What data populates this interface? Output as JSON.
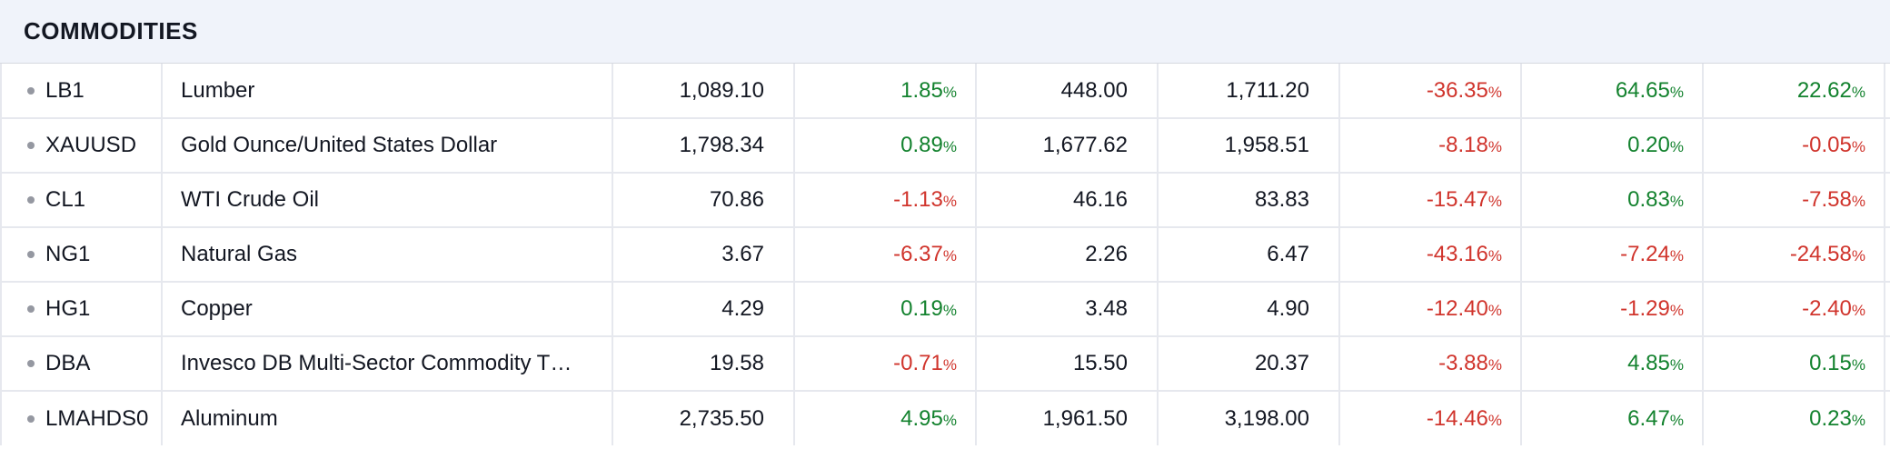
{
  "header": {
    "title": "COMMODITIES"
  },
  "rows": [
    {
      "symbol": "LB1",
      "name": "Lumber",
      "price": "1,089.10",
      "chg": {
        "value": "1.85",
        "unit": "%",
        "dir": "pos"
      },
      "low": "448.00",
      "high": "1,711.20",
      "p1": {
        "value": "-36.35",
        "unit": "%",
        "dir": "neg"
      },
      "p2": {
        "value": "64.65",
        "unit": "%",
        "dir": "pos"
      },
      "p3": {
        "value": "22.62",
        "unit": "%",
        "dir": "pos"
      }
    },
    {
      "symbol": "XAUUSD",
      "name": "Gold Ounce/United States Dollar",
      "price": "1,798.34",
      "chg": {
        "value": "0.89",
        "unit": "%",
        "dir": "pos"
      },
      "low": "1,677.62",
      "high": "1,958.51",
      "p1": {
        "value": "-8.18",
        "unit": "%",
        "dir": "neg"
      },
      "p2": {
        "value": "0.20",
        "unit": "%",
        "dir": "pos"
      },
      "p3": {
        "value": "-0.05",
        "unit": "%",
        "dir": "neg"
      }
    },
    {
      "symbol": "CL1",
      "name": "WTI Crude Oil",
      "price": "70.86",
      "chg": {
        "value": "-1.13",
        "unit": "%",
        "dir": "neg"
      },
      "low": "46.16",
      "high": "83.83",
      "p1": {
        "value": "-15.47",
        "unit": "%",
        "dir": "neg"
      },
      "p2": {
        "value": "0.83",
        "unit": "%",
        "dir": "pos"
      },
      "p3": {
        "value": "-7.58",
        "unit": "%",
        "dir": "neg"
      }
    },
    {
      "symbol": "NG1",
      "name": "Natural Gas",
      "price": "3.67",
      "chg": {
        "value": "-6.37",
        "unit": "%",
        "dir": "neg"
      },
      "low": "2.26",
      "high": "6.47",
      "p1": {
        "value": "-43.16",
        "unit": "%",
        "dir": "neg"
      },
      "p2": {
        "value": "-7.24",
        "unit": "%",
        "dir": "neg"
      },
      "p3": {
        "value": "-24.58",
        "unit": "%",
        "dir": "neg"
      }
    },
    {
      "symbol": "HG1",
      "name": "Copper",
      "price": "4.29",
      "chg": {
        "value": "0.19",
        "unit": "%",
        "dir": "pos"
      },
      "low": "3.48",
      "high": "4.90",
      "p1": {
        "value": "-12.40",
        "unit": "%",
        "dir": "neg"
      },
      "p2": {
        "value": "-1.29",
        "unit": "%",
        "dir": "neg"
      },
      "p3": {
        "value": "-2.40",
        "unit": "%",
        "dir": "neg"
      }
    },
    {
      "symbol": "DBA",
      "name": "Invesco DB Multi-Sector Commodity T…",
      "price": "19.58",
      "chg": {
        "value": "-0.71",
        "unit": "%",
        "dir": "neg"
      },
      "low": "15.50",
      "high": "20.37",
      "p1": {
        "value": "-3.88",
        "unit": "%",
        "dir": "neg"
      },
      "p2": {
        "value": "4.85",
        "unit": "%",
        "dir": "pos"
      },
      "p3": {
        "value": "0.15",
        "unit": "%",
        "dir": "pos"
      }
    },
    {
      "symbol": "LMAHDS0",
      "name": "Aluminum",
      "price": "2,735.50",
      "chg": {
        "value": "4.95",
        "unit": "%",
        "dir": "pos"
      },
      "low": "1,961.50",
      "high": "3,198.00",
      "p1": {
        "value": "-14.46",
        "unit": "%",
        "dir": "neg"
      },
      "p2": {
        "value": "6.47",
        "unit": "%",
        "dir": "pos"
      },
      "p3": {
        "value": "0.23",
        "unit": "%",
        "dir": "pos"
      }
    }
  ],
  "colors": {
    "positive": "#13822e",
    "negative": "#d0342c",
    "header_bg": "#f0f3fa",
    "grid": "#e6e8ee",
    "dot": "#9598a1"
  },
  "icons": {
    "row_marker": "bullet-dot-icon"
  }
}
